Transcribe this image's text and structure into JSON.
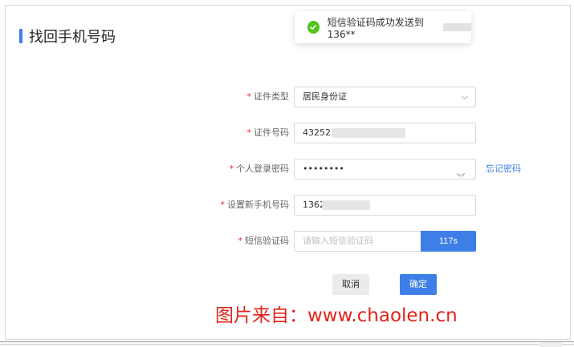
{
  "page": {
    "title": "找回手机号码"
  },
  "toast": {
    "message": "短信验证码成功发送到136**",
    "status": "success"
  },
  "form": {
    "id_type": {
      "label": "证件类型",
      "value": "居民身份证"
    },
    "id_number": {
      "label": "证件号码",
      "value": "432522"
    },
    "password": {
      "label": "个人登录密码",
      "value": "••••••••",
      "forgot_link": "忘记密码"
    },
    "new_phone": {
      "label": "设置新手机号码",
      "value": "1362"
    },
    "sms_code": {
      "label": "短信验证码",
      "placeholder": "请输入短信验证码",
      "countdown": "117s"
    }
  },
  "actions": {
    "cancel": "取消",
    "confirm": "确定"
  },
  "watermark": "图片来自：www.chaolen.cn",
  "colors": {
    "primary": "#3d7fe6",
    "required": "#f5222d",
    "success": "#52c41a",
    "watermark": "#e0241b"
  }
}
